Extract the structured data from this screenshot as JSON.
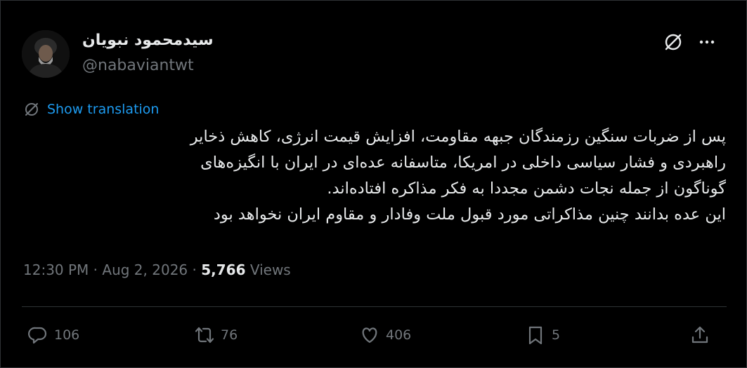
{
  "author": {
    "display_name": "سیدمحمود نبویان",
    "handle": "@nabaviantwt"
  },
  "translate": {
    "label": "Show translation"
  },
  "tweet": {
    "lines": [
      "پس از ضربات سنگین رزمندگان جبهه مقاومت، افزایش قیمت انرژی، کاهش ذخایر",
      "راهبردی و فشار سیاسی داخلی در امریکا، متاسفانه عده‌ای در ایران با انگیزه‌های",
      "گوناگون از جمله نجات دشمن مجددا به فکر مذاکره افتاده‌اند.",
      "این عده بدانند چنین مذاکراتی مورد قبول ملت وفادار و مقاوم ایران نخواهد بود"
    ]
  },
  "meta": {
    "time": "12:30 PM",
    "separator": "·",
    "date": "Aug 2, 2026",
    "views_count": "5,766",
    "views_label": "Views"
  },
  "actions": {
    "replies": "106",
    "reposts": "76",
    "likes": "406",
    "bookmarks": "5"
  },
  "icons": {
    "grok": "grok-icon",
    "more": "more-icon",
    "translate": "translate-icon",
    "reply": "reply-icon",
    "repost": "repost-icon",
    "like": "like-icon",
    "bookmark": "bookmark-icon",
    "share": "share-icon"
  },
  "colors": {
    "background": "#000000",
    "text": "#e7e9ea",
    "muted": "#71767b",
    "link": "#1d9bf0",
    "border": "#2f3336"
  }
}
